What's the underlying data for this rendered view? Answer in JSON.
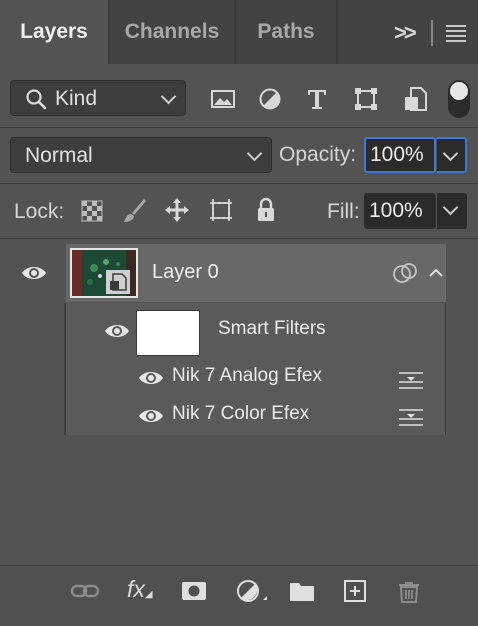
{
  "tabs": [
    {
      "label": "Layers",
      "active": true
    },
    {
      "label": "Channels",
      "active": false
    },
    {
      "label": "Paths",
      "active": false
    }
  ],
  "tabbar": {
    "overflow_label": ">>"
  },
  "filter": {
    "kind_label": "Kind"
  },
  "blend": {
    "mode": "Normal",
    "opacity_label": "Opacity:",
    "opacity_value": "100%"
  },
  "lock": {
    "label": "Lock:",
    "fill_label": "Fill:",
    "fill_value": "100%"
  },
  "layer": {
    "name": "Layer 0"
  },
  "smart_filters": {
    "label": "Smart Filters",
    "items": [
      "Nik 7 Analog Efex",
      "Nik 7 Color Efex"
    ]
  },
  "footer": {
    "fx_label": "fx"
  },
  "colors": {
    "accent": "#3a7bd5",
    "panel": "#535353",
    "selected": "#686868"
  }
}
